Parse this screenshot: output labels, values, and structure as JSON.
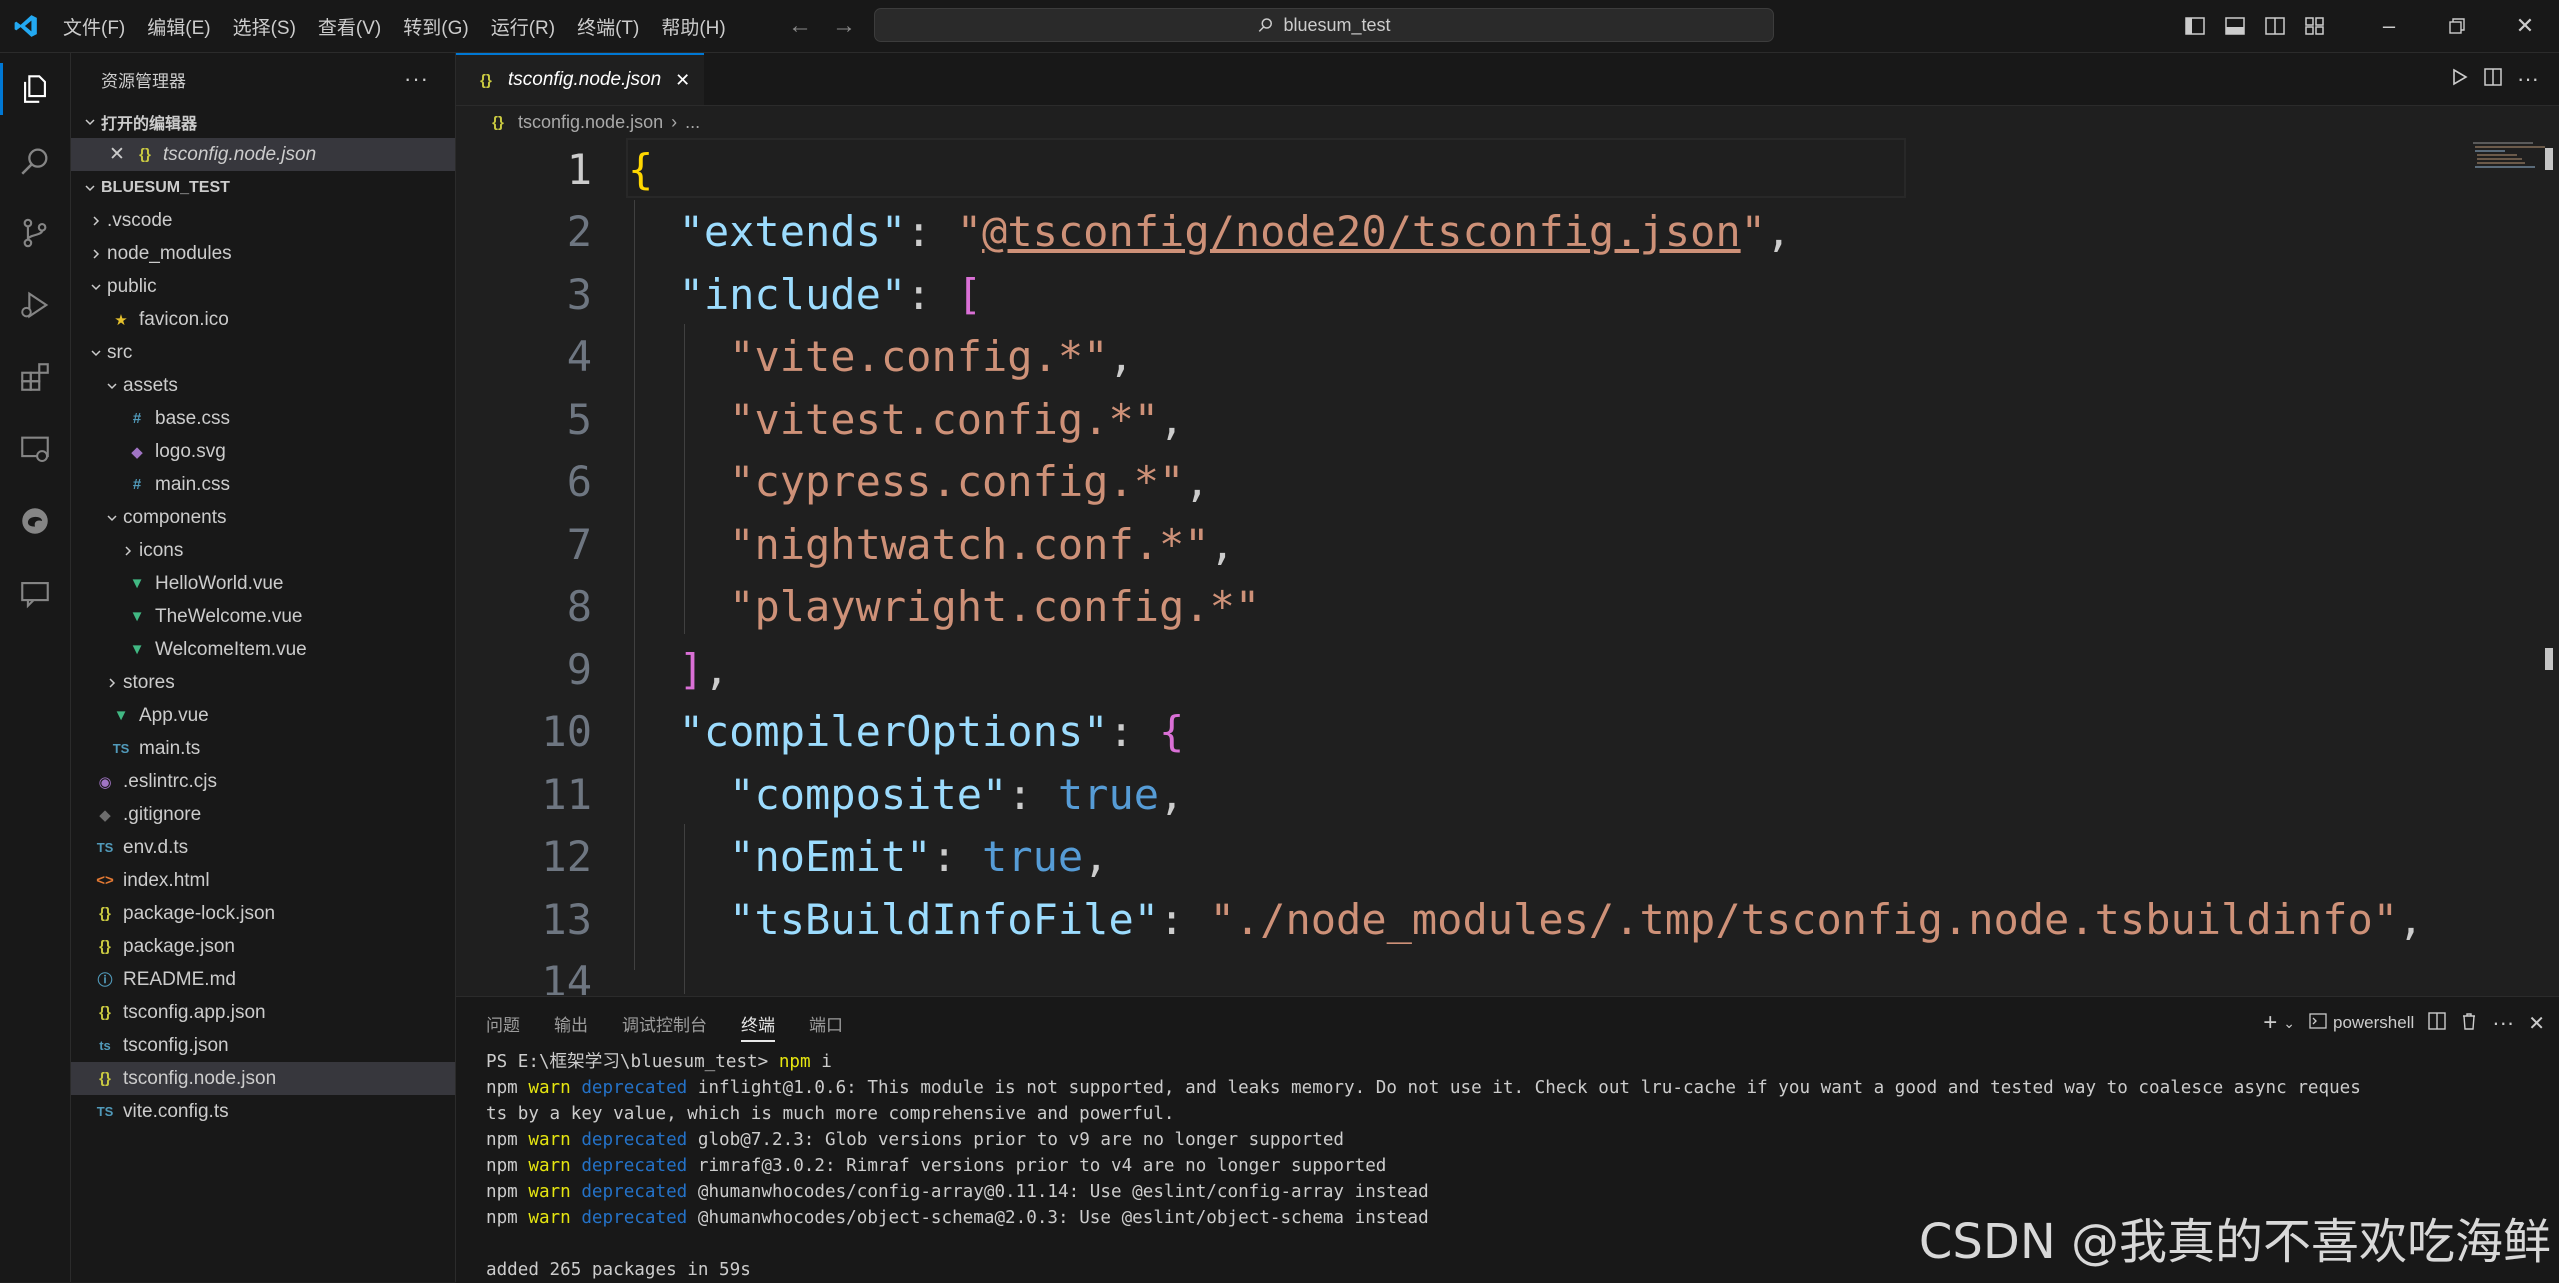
{
  "titlebar": {
    "menu": [
      "文件(F)",
      "编辑(E)",
      "选择(S)",
      "查看(V)",
      "转到(G)",
      "运行(R)",
      "终端(T)",
      "帮助(H)"
    ],
    "search": "bluesum_test"
  },
  "sidebar": {
    "title": "资源管理器",
    "open_editors_label": "打开的编辑器",
    "open_editor_file": "tsconfig.node.json",
    "project_label": "BLUESUM_TEST",
    "tree": [
      {
        "label": ".vscode",
        "type": "folder",
        "depth": 0,
        "expanded": false
      },
      {
        "label": "node_modules",
        "type": "folder",
        "depth": 0,
        "expanded": false
      },
      {
        "label": "public",
        "type": "folder",
        "depth": 0,
        "expanded": true
      },
      {
        "label": "favicon.ico",
        "type": "ico",
        "depth": 1
      },
      {
        "label": "src",
        "type": "folder",
        "depth": 0,
        "expanded": true
      },
      {
        "label": "assets",
        "type": "folder",
        "depth": 1,
        "expanded": true
      },
      {
        "label": "base.css",
        "type": "css",
        "depth": 2
      },
      {
        "label": "logo.svg",
        "type": "svg",
        "depth": 2
      },
      {
        "label": "main.css",
        "type": "css",
        "depth": 2
      },
      {
        "label": "components",
        "type": "folder",
        "depth": 1,
        "expanded": true
      },
      {
        "label": "icons",
        "type": "folder",
        "depth": 2,
        "expanded": false
      },
      {
        "label": "HelloWorld.vue",
        "type": "vue",
        "depth": 2
      },
      {
        "label": "TheWelcome.vue",
        "type": "vue",
        "depth": 2
      },
      {
        "label": "WelcomeItem.vue",
        "type": "vue",
        "depth": 2
      },
      {
        "label": "stores",
        "type": "folder",
        "depth": 1,
        "expanded": false
      },
      {
        "label": "App.vue",
        "type": "vue",
        "depth": 1
      },
      {
        "label": "main.ts",
        "type": "ts",
        "depth": 1
      },
      {
        "label": ".eslintrc.cjs",
        "type": "eslint",
        "depth": 0
      },
      {
        "label": ".gitignore",
        "type": "git",
        "depth": 0
      },
      {
        "label": "env.d.ts",
        "type": "ts",
        "depth": 0
      },
      {
        "label": "index.html",
        "type": "html",
        "depth": 0
      },
      {
        "label": "package-lock.json",
        "type": "json",
        "depth": 0
      },
      {
        "label": "package.json",
        "type": "json",
        "depth": 0
      },
      {
        "label": "README.md",
        "type": "md",
        "depth": 0
      },
      {
        "label": "tsconfig.app.json",
        "type": "json",
        "depth": 0
      },
      {
        "label": "tsconfig.json",
        "type": "tsconfig",
        "depth": 0
      },
      {
        "label": "tsconfig.node.json",
        "type": "json",
        "depth": 0,
        "selected": true
      },
      {
        "label": "vite.config.ts",
        "type": "ts",
        "depth": 0
      }
    ]
  },
  "editor": {
    "tab": "tsconfig.node.json",
    "breadcrumb_file": "tsconfig.node.json",
    "breadcrumb_more": "...",
    "current_line": 1,
    "lines": [
      {
        "n": "1",
        "tokens": [
          [
            "b1",
            "{"
          ]
        ]
      },
      {
        "n": "2",
        "tokens": [
          [
            "p",
            "  "
          ],
          [
            "k",
            "\"extends\""
          ],
          [
            "p",
            ": "
          ],
          [
            "s",
            "\""
          ],
          [
            "u",
            "@tsconfig/node20/tsconfig.json"
          ],
          [
            "s",
            "\""
          ],
          [
            "p",
            ","
          ]
        ]
      },
      {
        "n": "3",
        "tokens": [
          [
            "p",
            "  "
          ],
          [
            "k",
            "\"include\""
          ],
          [
            "p",
            ": "
          ],
          [
            "b2",
            "["
          ]
        ]
      },
      {
        "n": "4",
        "tokens": [
          [
            "p",
            "    "
          ],
          [
            "s",
            "\"vite.config.*\""
          ],
          [
            "p",
            ","
          ]
        ]
      },
      {
        "n": "5",
        "tokens": [
          [
            "p",
            "    "
          ],
          [
            "s",
            "\"vitest.config.*\""
          ],
          [
            "p",
            ","
          ]
        ]
      },
      {
        "n": "6",
        "tokens": [
          [
            "p",
            "    "
          ],
          [
            "s",
            "\"cypress.config.*\""
          ],
          [
            "p",
            ","
          ]
        ]
      },
      {
        "n": "7",
        "tokens": [
          [
            "p",
            "    "
          ],
          [
            "s",
            "\"nightwatch.conf.*\""
          ],
          [
            "p",
            ","
          ]
        ]
      },
      {
        "n": "8",
        "tokens": [
          [
            "p",
            "    "
          ],
          [
            "s",
            "\"playwright.config.*\""
          ]
        ]
      },
      {
        "n": "9",
        "tokens": [
          [
            "p",
            "  "
          ],
          [
            "b2",
            "]"
          ],
          [
            "p",
            ","
          ]
        ]
      },
      {
        "n": "10",
        "tokens": [
          [
            "p",
            "  "
          ],
          [
            "k",
            "\"compilerOptions\""
          ],
          [
            "p",
            ": "
          ],
          [
            "b2",
            "{"
          ]
        ]
      },
      {
        "n": "11",
        "tokens": [
          [
            "p",
            "    "
          ],
          [
            "k",
            "\"composite\""
          ],
          [
            "p",
            ": "
          ],
          [
            "bool",
            "true"
          ],
          [
            "p",
            ","
          ]
        ]
      },
      {
        "n": "12",
        "tokens": [
          [
            "p",
            "    "
          ],
          [
            "k",
            "\"noEmit\""
          ],
          [
            "p",
            ": "
          ],
          [
            "bool",
            "true"
          ],
          [
            "p",
            ","
          ]
        ]
      },
      {
        "n": "13",
        "tokens": [
          [
            "p",
            "    "
          ],
          [
            "k",
            "\"tsBuildInfoFile\""
          ],
          [
            "p",
            ": "
          ],
          [
            "s",
            "\"./node_modules/.tmp/tsconfig.node.tsbuildinfo\""
          ],
          [
            "p",
            ","
          ]
        ]
      },
      {
        "n": "14",
        "tokens": []
      }
    ]
  },
  "panel": {
    "tabs": [
      "问题",
      "输出",
      "调试控制台",
      "终端",
      "端口"
    ],
    "active_tab": "终端",
    "shell": "powershell",
    "terminal": [
      [
        [
          "p",
          "PS E:\\框架学习\\bluesum_test> "
        ],
        [
          "warn",
          "npm"
        ],
        [
          "p",
          " i"
        ]
      ],
      [
        [
          "p",
          "npm "
        ],
        [
          "warn",
          "warn"
        ],
        [
          "p",
          " "
        ],
        [
          "dep",
          "deprecated"
        ],
        [
          "p",
          " inflight@1.0.6: This module is not supported, and leaks memory. Do not use it. Check out lru-cache if you want a good and tested way to coalesce async reques"
        ]
      ],
      [
        [
          "p",
          "ts by a key value, which is much more comprehensive and powerful."
        ]
      ],
      [
        [
          "p",
          "npm "
        ],
        [
          "warn",
          "warn"
        ],
        [
          "p",
          " "
        ],
        [
          "dep",
          "deprecated"
        ],
        [
          "p",
          " glob@7.2.3: Glob versions prior to v9 are no longer supported"
        ]
      ],
      [
        [
          "p",
          "npm "
        ],
        [
          "warn",
          "warn"
        ],
        [
          "p",
          " "
        ],
        [
          "dep",
          "deprecated"
        ],
        [
          "p",
          " rimraf@3.0.2: Rimraf versions prior to v4 are no longer supported"
        ]
      ],
      [
        [
          "p",
          "npm "
        ],
        [
          "warn",
          "warn"
        ],
        [
          "p",
          " "
        ],
        [
          "dep",
          "deprecated"
        ],
        [
          "p",
          " @humanwhocodes/config-array@0.11.14: Use @eslint/config-array instead"
        ]
      ],
      [
        [
          "p",
          "npm "
        ],
        [
          "warn",
          "warn"
        ],
        [
          "p",
          " "
        ],
        [
          "dep",
          "deprecated"
        ],
        [
          "p",
          " @humanwhocodes/object-schema@2.0.3: Use @eslint/object-schema instead"
        ]
      ],
      [
        [
          "p",
          ""
        ]
      ],
      [
        [
          "p",
          "added 265 packages in 59s"
        ]
      ]
    ]
  },
  "watermark": "CSDN @我真的不喜欢吃海鲜"
}
